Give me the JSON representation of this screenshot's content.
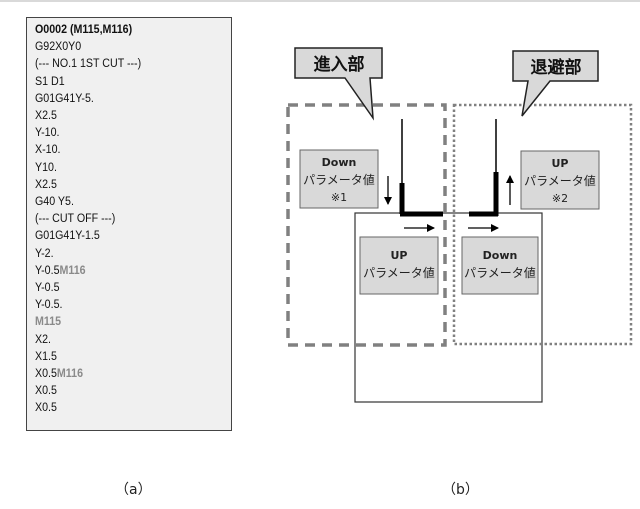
{
  "panel_a": {
    "caption": "（a）",
    "program_lines": [
      {
        "text": "O0002 (M115,M116)",
        "bold": true,
        "m_code": ""
      },
      {
        "text": "G92X0Y0",
        "bold": false,
        "m_code": ""
      },
      {
        "text": "(--- NO.1 1ST CUT ---)",
        "bold": false,
        "m_code": ""
      },
      {
        "text": "S1 D1",
        "bold": false,
        "m_code": ""
      },
      {
        "text": "G01G41Y-5.",
        "bold": false,
        "m_code": ""
      },
      {
        "text": "X2.5",
        "bold": false,
        "m_code": ""
      },
      {
        "text": "Y-10.",
        "bold": false,
        "m_code": ""
      },
      {
        "text": "X-10.",
        "bold": false,
        "m_code": ""
      },
      {
        "text": "Y10.",
        "bold": false,
        "m_code": ""
      },
      {
        "text": "X2.5",
        "bold": false,
        "m_code": ""
      },
      {
        "text": "G40 Y5.",
        "bold": false,
        "m_code": ""
      },
      {
        "text": "(--- CUT OFF ---)",
        "bold": false,
        "m_code": ""
      },
      {
        "text": "G01G41Y-1.5",
        "bold": false,
        "m_code": ""
      },
      {
        "text": "Y-2.",
        "bold": false,
        "m_code": ""
      },
      {
        "text": "Y-0.5",
        "bold": false,
        "m_code": "M116"
      },
      {
        "text": "Y-0.5",
        "bold": false,
        "m_code": ""
      },
      {
        "text": "Y-0.5.",
        "bold": false,
        "m_code": ""
      },
      {
        "text": "",
        "bold": false,
        "m_code": "M115"
      },
      {
        "text": "X2.",
        "bold": false,
        "m_code": ""
      },
      {
        "text": "X1.5",
        "bold": false,
        "m_code": ""
      },
      {
        "text": "X0.5",
        "bold": false,
        "m_code": "M116"
      },
      {
        "text": "X0.5",
        "bold": false,
        "m_code": ""
      },
      {
        "text": "X0.5",
        "bold": false,
        "m_code": ""
      }
    ]
  },
  "panel_b": {
    "caption": "（b）",
    "callouts": {
      "approach": "進入部",
      "retreat": "退避部"
    },
    "param_boxes": {
      "approach_down": {
        "line1": "Down",
        "line2": "パラメータ値",
        "line3": "※1"
      },
      "retreat_up": {
        "line1": "UP",
        "line2": "パラメータ値",
        "line3": "※2"
      },
      "approach_up": {
        "line1": "UP",
        "line2": "パラメータ値"
      },
      "retreat_down": {
        "line1": "Down",
        "line2": "パラメータ値"
      }
    },
    "colors": {
      "box_fill": "#d9d9d9",
      "dashed_frame": "#808080",
      "wire_path": "#000000"
    }
  }
}
